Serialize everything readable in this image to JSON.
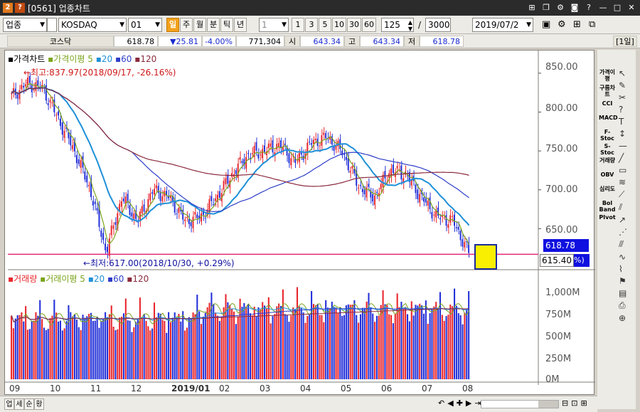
{
  "window": {
    "badge1": "2",
    "badge2": "?",
    "title": "[0561] 업종차트",
    "controls": [
      "pin",
      "copy",
      "settings",
      "screenshot",
      "help",
      "minimize",
      "maximize",
      "close"
    ]
  },
  "toolbar": {
    "market_select": "업종",
    "index_name": "KOSDAQ",
    "code_input": "01",
    "period_buttons": [
      "일",
      "주",
      "월",
      "분",
      "틱",
      "년"
    ],
    "active_period": "일",
    "minute_value": "1",
    "minute_buttons": [
      "1",
      "3",
      "5",
      "10",
      "30",
      "60"
    ],
    "count_value": "125",
    "separator": "/",
    "total_value": "3000",
    "date_value": "2019/07/2",
    "right_icons": [
      "save-icon",
      "settings-icon",
      "chart-layout-icon",
      "chart-compare-icon"
    ]
  },
  "quote": {
    "name": "코스닥",
    "price": "618.78",
    "change": "▼25.81",
    "change_rate": "-4.00%",
    "volume": "771,304",
    "open_label": "시",
    "open": "643.34",
    "high_label": "고",
    "high": "643.34",
    "low_label": "저",
    "low": "618.78",
    "period_tag": "[1일]"
  },
  "price_panel": {
    "legend_title": "가격차트",
    "legend_ma": "가격이평",
    "ma_periods": [
      "5",
      "20",
      "60",
      "120"
    ],
    "ma_colors": [
      "#7aa51c",
      "#1e90d8",
      "#2e3ec8",
      "#8b2a3c"
    ],
    "high_annotation": "←최고:837.97(2018/09/17, -26.16%)",
    "low_annotation": "←최저:617.00(2018/10/30, +0.29%)",
    "y_ticks": [
      "850.00",
      "800.00",
      "750.00",
      "700.00",
      "650.00"
    ],
    "current_price_tag": "618.78",
    "crosshair_price_tag": "615.40",
    "pct_tag": "%)"
  },
  "volume_panel": {
    "legend_title": "거래량",
    "legend_ma": "거래이평",
    "ma_periods": [
      "5",
      "20",
      "60",
      "120"
    ],
    "y_ticks": [
      "1,000M",
      "750M",
      "500M",
      "250M",
      "0M"
    ]
  },
  "x_axis": {
    "labels": [
      "09",
      "10",
      "11",
      "12",
      "2019/01",
      "02",
      "03",
      "04",
      "05",
      "06",
      "07",
      "08"
    ]
  },
  "right_toolbar": {
    "items": [
      "가격이평",
      "구름차트",
      "CCI",
      "MACD",
      "F-Stoc",
      "S-Stoc",
      "거래량",
      "OBV",
      "심리도",
      "Bol Band",
      "PIvot"
    ]
  },
  "bottom_bar": {
    "buttons": [
      "업",
      "세",
      "순",
      "황"
    ]
  },
  "colors": {
    "up": "#e8262c",
    "down": "#2230d8",
    "hline": "#e0287a",
    "accent": "#f2a21b",
    "current_tag_bg": "#1010e0"
  },
  "chart_data": {
    "type": "candlestick",
    "x_start": "2018/09",
    "x_end": "2019/08",
    "ylim": [
      600,
      870
    ],
    "volume_ylim": [
      0,
      1150
    ],
    "volume_unit": "M",
    "price_series": [
      {
        "date": "2018/09/03",
        "close": 820
      },
      {
        "date": "2018/09/17",
        "close": 837
      },
      {
        "date": "2018/09/28",
        "close": 830
      },
      {
        "date": "2018/10/05",
        "close": 790
      },
      {
        "date": "2018/10/12",
        "close": 750
      },
      {
        "date": "2018/10/22",
        "close": 700
      },
      {
        "date": "2018/10/30",
        "close": 620
      },
      {
        "date": "2018/11/08",
        "close": 690
      },
      {
        "date": "2018/11/20",
        "close": 660
      },
      {
        "date": "2018/11/30",
        "close": 700
      },
      {
        "date": "2018/12/07",
        "close": 690
      },
      {
        "date": "2018/12/20",
        "close": 660
      },
      {
        "date": "2019/01/03",
        "close": 665
      },
      {
        "date": "2019/01/15",
        "close": 690
      },
      {
        "date": "2019/01/30",
        "close": 720
      },
      {
        "date": "2019/02/15",
        "close": 745
      },
      {
        "date": "2019/02/28",
        "close": 750
      },
      {
        "date": "2019/03/12",
        "close": 758
      },
      {
        "date": "2019/03/25",
        "close": 735
      },
      {
        "date": "2019/04/10",
        "close": 760
      },
      {
        "date": "2019/04/22",
        "close": 768
      },
      {
        "date": "2019/05/03",
        "close": 748
      },
      {
        "date": "2019/05/15",
        "close": 705
      },
      {
        "date": "2019/05/28",
        "close": 690
      },
      {
        "date": "2019/06/10",
        "close": 725
      },
      {
        "date": "2019/06/25",
        "close": 720
      },
      {
        "date": "2019/07/05",
        "close": 690
      },
      {
        "date": "2019/07/15",
        "close": 665
      },
      {
        "date": "2019/07/24",
        "close": 660
      },
      {
        "date": "2019/07/31",
        "close": 618.78
      }
    ],
    "moving_averages": [
      {
        "name": "5",
        "color": "#7aa51c"
      },
      {
        "name": "20",
        "color": "#1e90d8"
      },
      {
        "name": "60",
        "color": "#2e3ec8"
      },
      {
        "name": "120",
        "color": "#8b2a3c"
      }
    ],
    "reference_line": 617.0
  }
}
